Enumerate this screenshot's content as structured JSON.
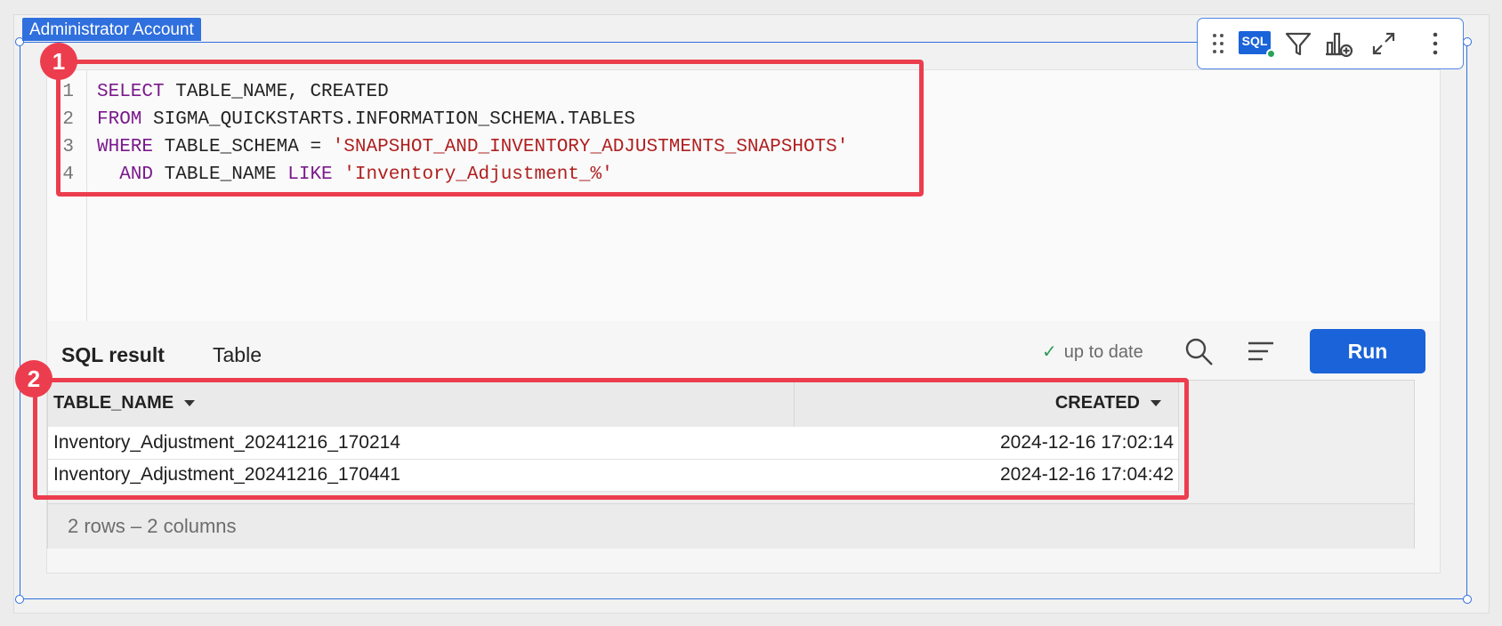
{
  "element_label": "Administrator Account",
  "toolbar": {
    "sql_badge": "SQL",
    "icons": [
      "drag-handle-icon",
      "sql-icon",
      "filter-icon",
      "add-chart-icon",
      "expand-icon",
      "more-icon"
    ]
  },
  "editor": {
    "line_numbers": [
      "1",
      "2",
      "3",
      "4"
    ],
    "lines": [
      [
        {
          "t": "SELECT",
          "k": "kw"
        },
        {
          "t": " TABLE_NAME, CREATED",
          "k": "id"
        }
      ],
      [
        {
          "t": "FROM",
          "k": "kw"
        },
        {
          "t": " SIGMA_QUICKSTARTS.INFORMATION_SCHEMA.TABLES",
          "k": "id"
        }
      ],
      [
        {
          "t": "WHERE",
          "k": "kw"
        },
        {
          "t": " TABLE_SCHEMA = ",
          "k": "id"
        },
        {
          "t": "'SNAPSHOT_AND_INVENTORY_ADJUSTMENTS_SNAPSHOTS'",
          "k": "str"
        }
      ],
      [
        {
          "t": "  AND",
          "k": "kw"
        },
        {
          "t": " TABLE_NAME ",
          "k": "id"
        },
        {
          "t": "LIKE",
          "k": "kw"
        },
        {
          "t": " ",
          "k": "id"
        },
        {
          "t": "'Inventory_Adjustment_%'",
          "k": "str"
        }
      ]
    ]
  },
  "result_tabs": [
    "SQL result",
    "Table"
  ],
  "status_text": "up to date",
  "run_label": "Run",
  "grid": {
    "columns": [
      "TABLE_NAME",
      "CREATED"
    ],
    "rows": [
      [
        "Inventory_Adjustment_20241216_170214",
        "2024-12-16 17:02:14"
      ],
      [
        "Inventory_Adjustment_20241216_170441",
        "2024-12-16 17:04:42"
      ]
    ],
    "footer": "2 rows – 2 columns"
  },
  "markers": [
    "1",
    "2"
  ],
  "colors": {
    "accent": "#1b63d8",
    "callout": "#ec3d4e",
    "keyword": "#7a1a8c",
    "string": "#b02020"
  }
}
